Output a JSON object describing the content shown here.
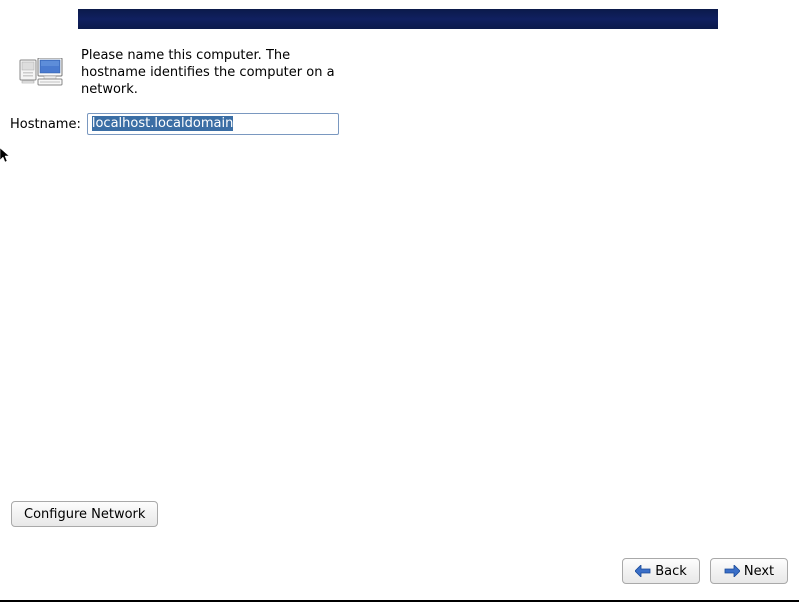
{
  "banner": {
    "color_start": "#0b1a4a",
    "color_end": "#102060"
  },
  "description_text": "Please name this computer.  The hostname identifies the computer on a network.",
  "hostname": {
    "label": "Hostname:",
    "value": "localhost.localdomain"
  },
  "buttons": {
    "configure_network": "Configure Network",
    "back": "Back",
    "next": "Next"
  },
  "icons": {
    "network": "network-computers-icon",
    "back_arrow": "arrow-left-icon",
    "next_arrow": "arrow-right-icon"
  }
}
